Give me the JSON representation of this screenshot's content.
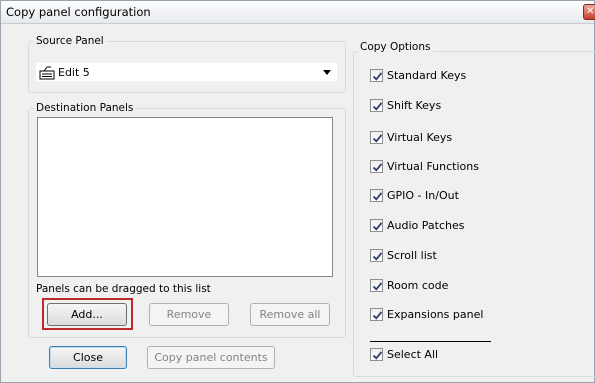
{
  "window": {
    "title": "Copy panel configuration"
  },
  "source_panel": {
    "label": "Source Panel",
    "value": "Edit 5",
    "icon": "keyboard-icon"
  },
  "destination_panels": {
    "label": "Destination Panels",
    "items": [],
    "hint": "Panels can be dragged to this list",
    "add_label": "Add...",
    "remove_label": "Remove",
    "remove_all_label": "Remove all"
  },
  "copy_options": {
    "label": "Copy Options",
    "options": [
      {
        "label": "Standard Keys",
        "checked": true
      },
      {
        "label": "Shift Keys",
        "checked": true
      },
      {
        "label": "Virtual Keys",
        "checked": true
      },
      {
        "label": "Virtual Functions",
        "checked": true
      },
      {
        "label": "GPIO - In/Out",
        "checked": true
      },
      {
        "label": "Audio Patches",
        "checked": true
      },
      {
        "label": "Scroll list",
        "checked": true
      },
      {
        "label": "Room code",
        "checked": true
      },
      {
        "label": "Expansions panel",
        "checked": true
      }
    ],
    "select_all": {
      "label": "Select All",
      "checked": true
    }
  },
  "footer": {
    "close_label": "Close",
    "copy_label": "Copy panel contents"
  },
  "colors": {
    "highlight": "#c0282d",
    "accent": "#3c7fb1"
  }
}
